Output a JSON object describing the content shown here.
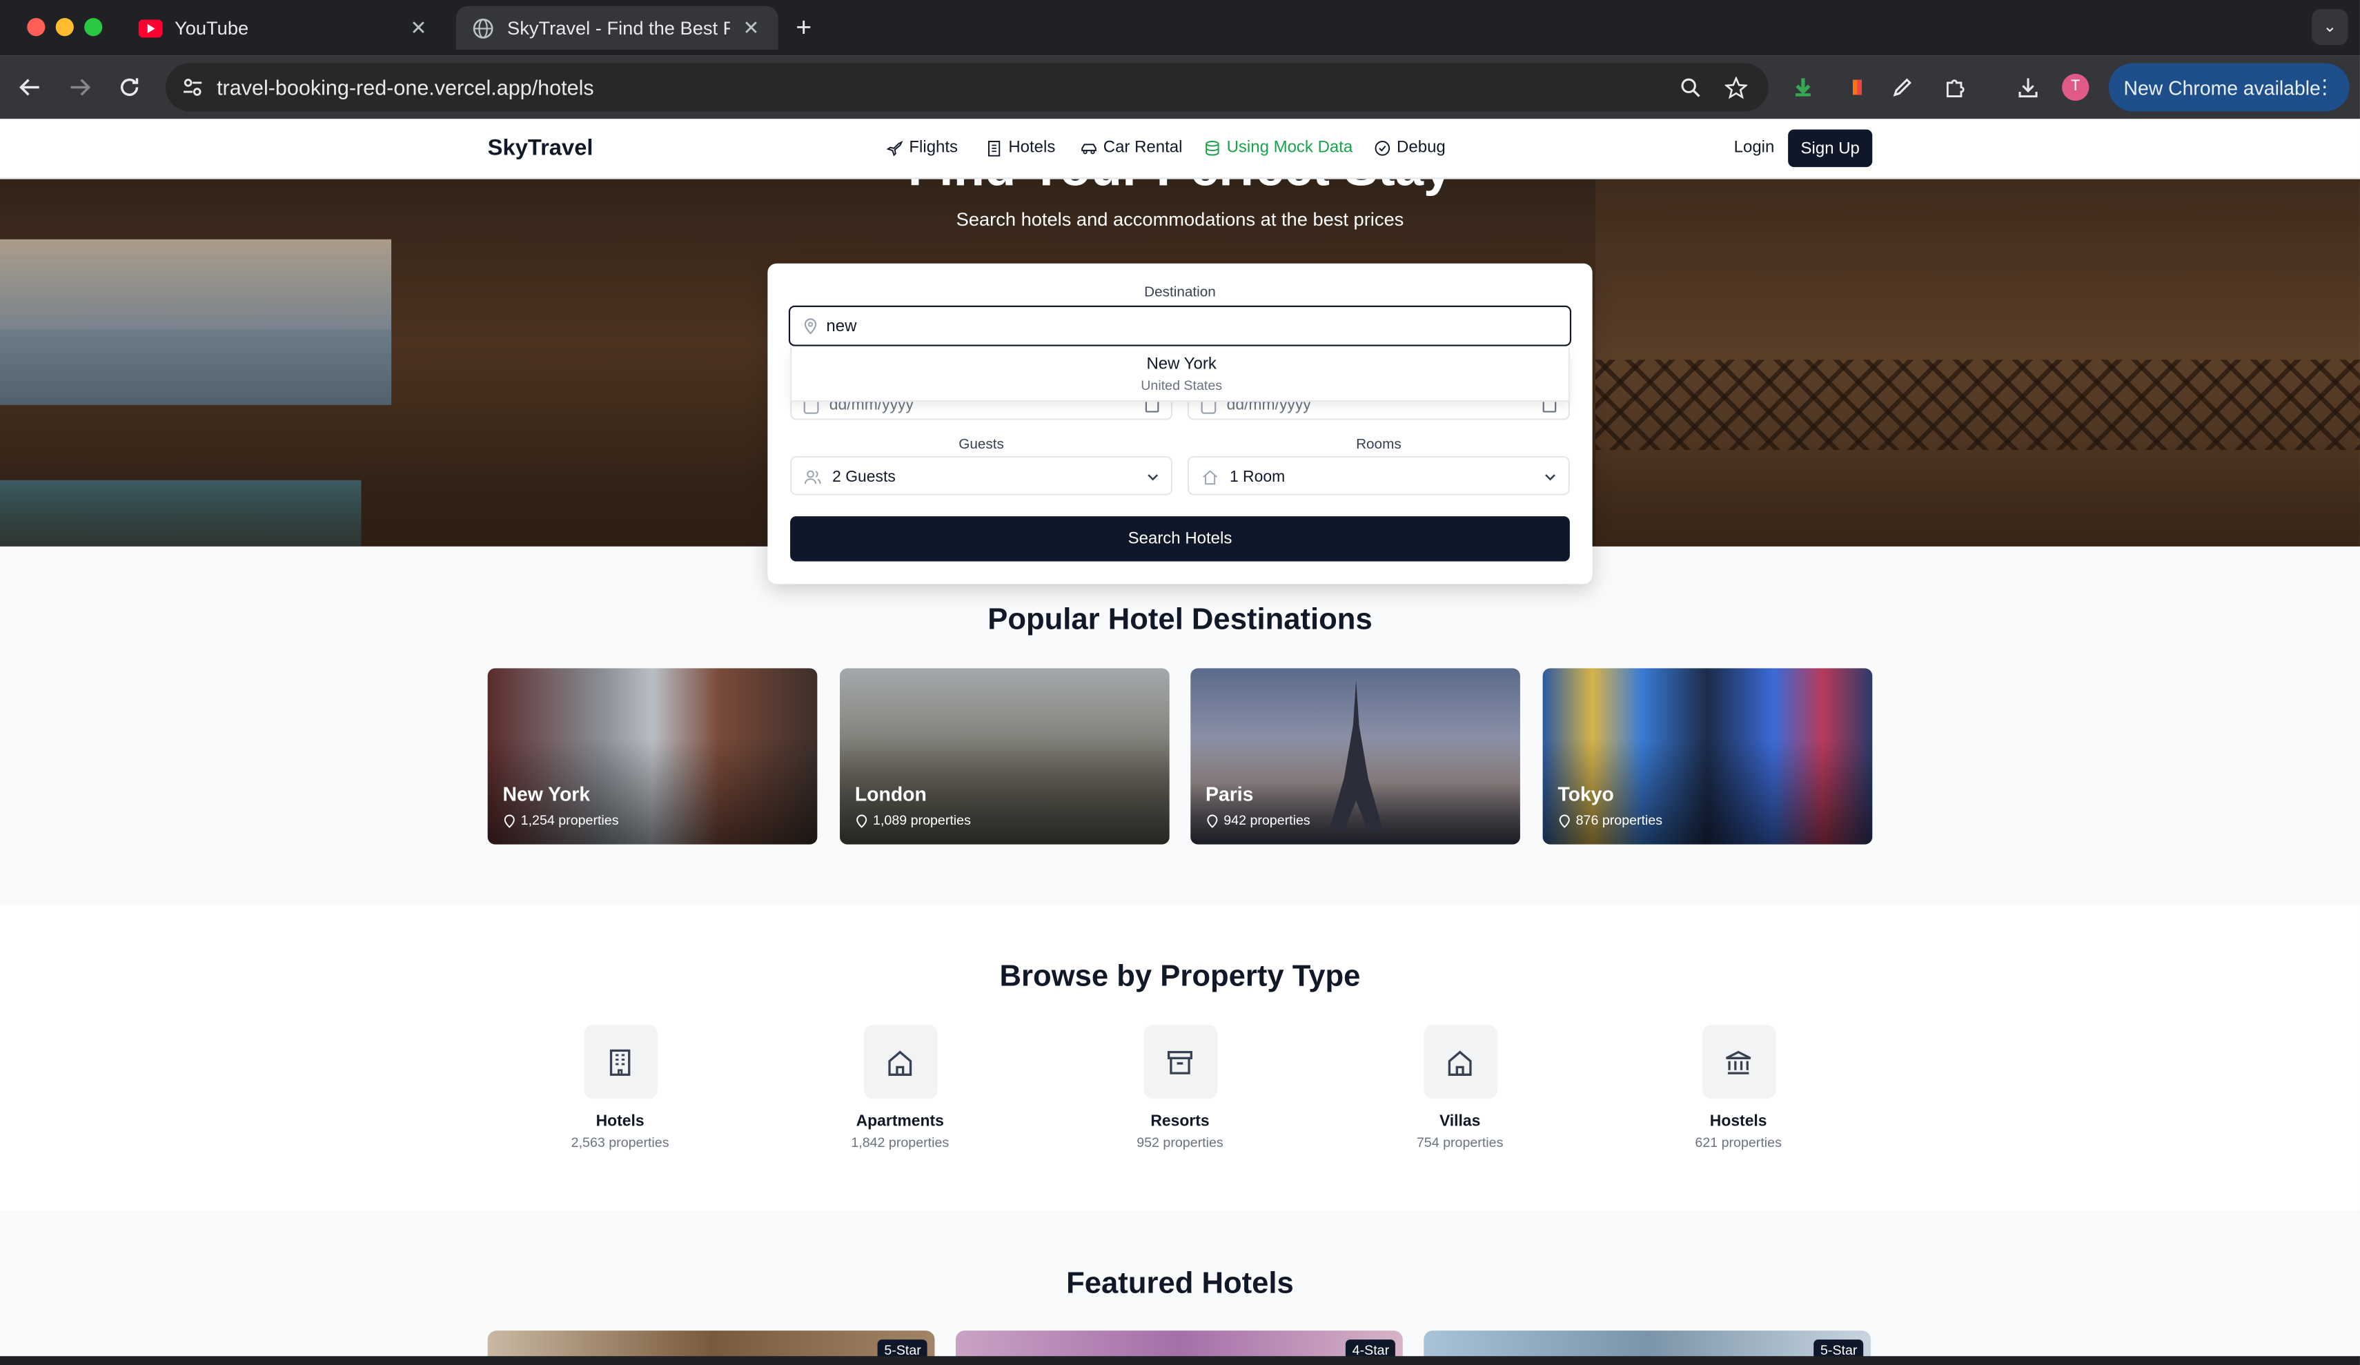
{
  "browser": {
    "tabs": [
      {
        "title": "YouTube",
        "active": false
      },
      {
        "title": "SkyTravel - Find the Best Flig",
        "active": true
      }
    ],
    "url_host": "travel-booking-red-one.vercel.app",
    "url_path": "/hotels",
    "update_button": "New Chrome available",
    "profile_initial": "T"
  },
  "nav": {
    "brand": "SkyTravel",
    "links": [
      {
        "label": "Flights",
        "icon": "plane-icon"
      },
      {
        "label": "Hotels",
        "icon": "building-icon"
      },
      {
        "label": "Car Rental",
        "icon": "car-icon"
      },
      {
        "label": "Using Mock Data",
        "icon": "database-icon"
      },
      {
        "label": "Debug",
        "icon": "check-circle-icon"
      }
    ],
    "login": "Login",
    "signup": "Sign Up",
    "mock_color": "#16a34a"
  },
  "hero": {
    "title": "Find Your Perfect Stay",
    "subtitle": "Search hotels and accommodations at the best prices"
  },
  "search": {
    "destination_label": "Destination",
    "destination_value": "new",
    "suggestion_city": "New York",
    "suggestion_country": "United States",
    "checkin_placeholder": "dd/mm/yyyy",
    "checkout_placeholder": "dd/mm/yyyy",
    "guests_label": "Guests",
    "guests_value": "2 Guests",
    "rooms_label": "Rooms",
    "rooms_value": "1 Room",
    "button": "Search Hotels"
  },
  "popular": {
    "title": "Popular Hotel Destinations",
    "items": [
      {
        "name": "New York",
        "count": "1,254 properties"
      },
      {
        "name": "London",
        "count": "1,089 properties"
      },
      {
        "name": "Paris",
        "count": "942 properties"
      },
      {
        "name": "Tokyo",
        "count": "876 properties"
      }
    ]
  },
  "property_types": {
    "title": "Browse by Property Type",
    "items": [
      {
        "name": "Hotels",
        "count": "2,563 properties",
        "icon": "building-icon"
      },
      {
        "name": "Apartments",
        "count": "1,842 properties",
        "icon": "home-icon"
      },
      {
        "name": "Resorts",
        "count": "952 properties",
        "icon": "archive-icon"
      },
      {
        "name": "Villas",
        "count": "754 properties",
        "icon": "home-icon"
      },
      {
        "name": "Hostels",
        "count": "621 properties",
        "icon": "landmark-icon"
      }
    ]
  },
  "featured": {
    "title": "Featured Hotels",
    "badges": [
      "5-Star",
      "4-Star",
      "5-Star"
    ]
  },
  "colors": {
    "primary": "#0f172a",
    "chrome_dark": "#202124",
    "chrome_toolbar": "#35363a",
    "update_button": "#1f4f8b"
  }
}
